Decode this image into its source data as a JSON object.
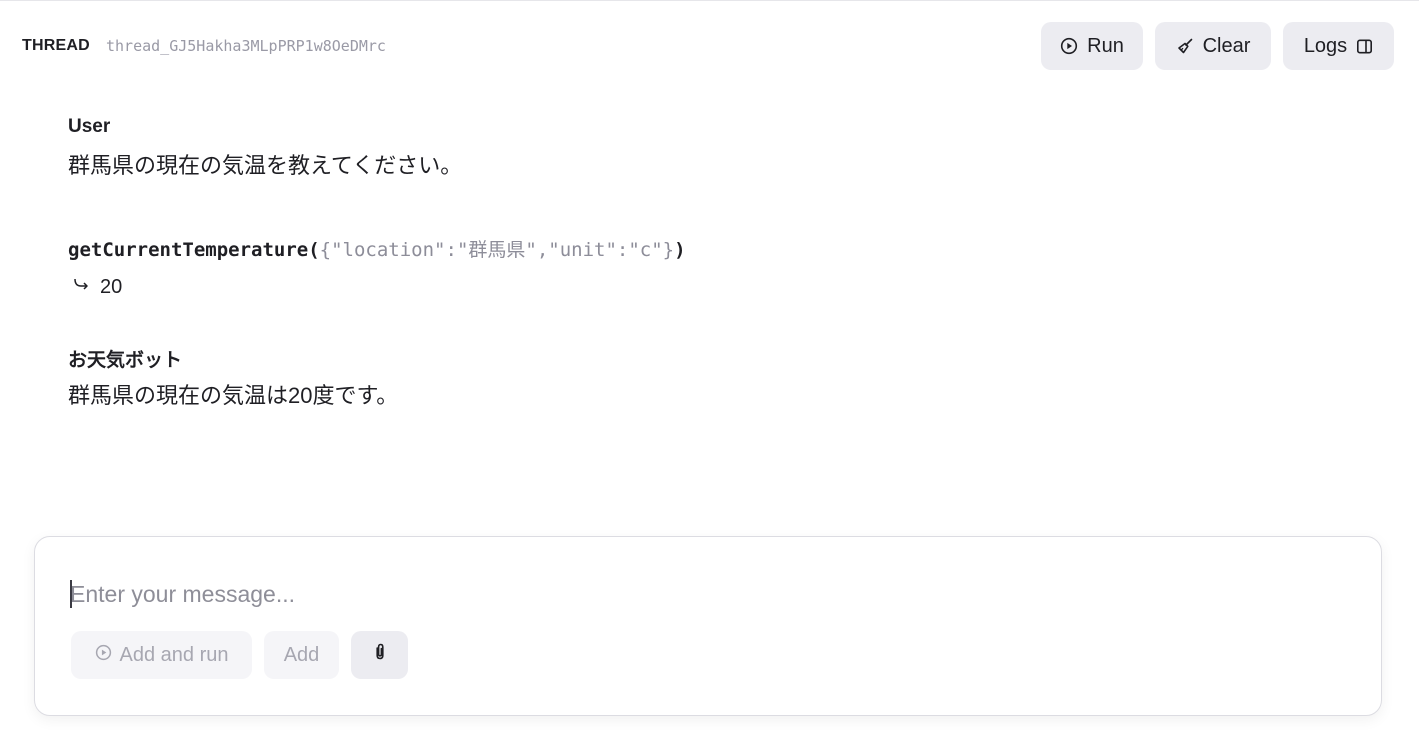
{
  "header": {
    "thread_label": "THREAD",
    "thread_id": "thread_GJ5Hakha3MLpPRP1w8OeDMrc",
    "buttons": {
      "run": "Run",
      "clear": "Clear",
      "logs": "Logs"
    }
  },
  "messages": [
    {
      "role": "User",
      "text": "群馬県の現在の気温を教えてください。"
    },
    {
      "function_call": {
        "name": "getCurrentTemperature(",
        "args": "{\"location\":\"群馬県\",\"unit\":\"c\"}",
        "close": ")",
        "result": "20"
      }
    },
    {
      "role": "お天気ボット",
      "text": "群馬県の現在の気温は20度です。"
    }
  ],
  "composer": {
    "placeholder": "Enter your message...",
    "value": "",
    "buttons": {
      "add_and_run": "Add and run",
      "add": "Add"
    }
  },
  "icons": {
    "run": "play-circle-icon",
    "clear": "broom-icon",
    "logs": "sidebar-panel-icon",
    "result": "return-arrow-icon",
    "attach": "paperclip-icon"
  },
  "colors": {
    "button_bg": "#ececf1",
    "disabled_button_bg": "#f5f5f8",
    "muted_text": "#9a9aa6",
    "text": "#1f1f24"
  }
}
